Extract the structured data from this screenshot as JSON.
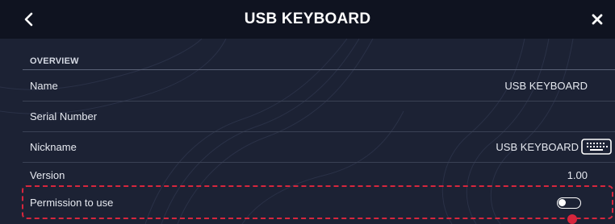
{
  "header": {
    "title": "USB KEYBOARD",
    "back_icon": "chevron-left-icon",
    "close_icon": "close-icon"
  },
  "overview": {
    "section_label": "OVERVIEW",
    "rows": [
      {
        "label": "Name",
        "value": "USB KEYBOARD"
      },
      {
        "label": "Serial Number",
        "value": ""
      },
      {
        "label": "Nickname",
        "value": "USB KEYBOARD",
        "icon": "keyboard-icon"
      },
      {
        "label": "Version",
        "value": "1.00"
      },
      {
        "label": "Permission to use",
        "toggle": false
      }
    ]
  },
  "colors": {
    "header_bg": "#0f1320",
    "body_bg": "#1c2234",
    "highlight": "#d7263d"
  }
}
